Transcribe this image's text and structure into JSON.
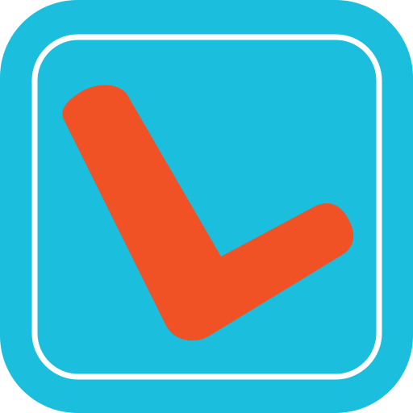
{
  "app_icon": {
    "icon_name": "checkmark-icon",
    "colors": {
      "tile_background": "#1BBEDC",
      "inner_border": "#FFFFFF",
      "checkmark": "#F05125",
      "page_background": "#FFFFFF"
    }
  }
}
